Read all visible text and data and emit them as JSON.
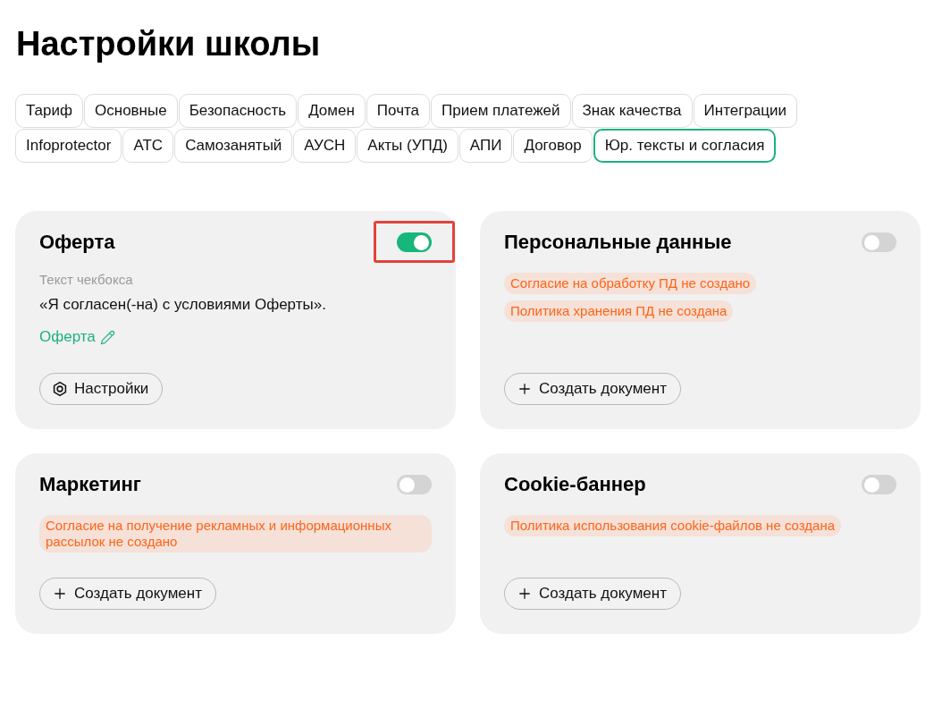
{
  "page": {
    "title": "Настройки школы"
  },
  "tabs": [
    {
      "label": "Тариф",
      "selected": false
    },
    {
      "label": "Основные",
      "selected": false
    },
    {
      "label": "Безопасность",
      "selected": false
    },
    {
      "label": "Домен",
      "selected": false
    },
    {
      "label": "Почта",
      "selected": false
    },
    {
      "label": "Прием платежей",
      "selected": false
    },
    {
      "label": "Знак качества",
      "selected": false
    },
    {
      "label": "Интеграции",
      "selected": false
    },
    {
      "label": "Infoprotector",
      "selected": false
    },
    {
      "label": "АТС",
      "selected": false
    },
    {
      "label": "Самозанятый",
      "selected": false
    },
    {
      "label": "АУСН",
      "selected": false
    },
    {
      "label": "Акты (УПД)",
      "selected": false
    },
    {
      "label": "АПИ",
      "selected": false
    },
    {
      "label": "Договор",
      "selected": false
    },
    {
      "label": "Юр. тексты и согласия",
      "selected": true
    }
  ],
  "cards": [
    {
      "title": "Оферта",
      "on": true,
      "highlighted": true,
      "checkbox_text": {
        "label": "Текст чекбокса",
        "value": "«Я согласен(-на) с условиями Оферты»."
      },
      "link": {
        "label": "Оферта"
      },
      "button": {
        "kind": "settings",
        "label": "Настройки"
      }
    },
    {
      "title": "Персональные данные",
      "on": false,
      "highlighted": false,
      "warnings": [
        "Согласие на обработку ПД не создано",
        "Политика хранения ПД не создана"
      ],
      "button": {
        "kind": "create",
        "label": "Создать документ"
      }
    },
    {
      "title": "Маркетинг",
      "on": false,
      "highlighted": false,
      "warnings": [
        "Согласие на получение рекламных и информационных рассылок не создано"
      ],
      "button": {
        "kind": "create",
        "label": "Создать документ"
      }
    },
    {
      "title": "Cookie-баннер",
      "on": false,
      "highlighted": false,
      "warnings": [
        "Политика использования cookie-файлов не создана"
      ],
      "button": {
        "kind": "create",
        "label": "Создать документ"
      }
    }
  ]
}
